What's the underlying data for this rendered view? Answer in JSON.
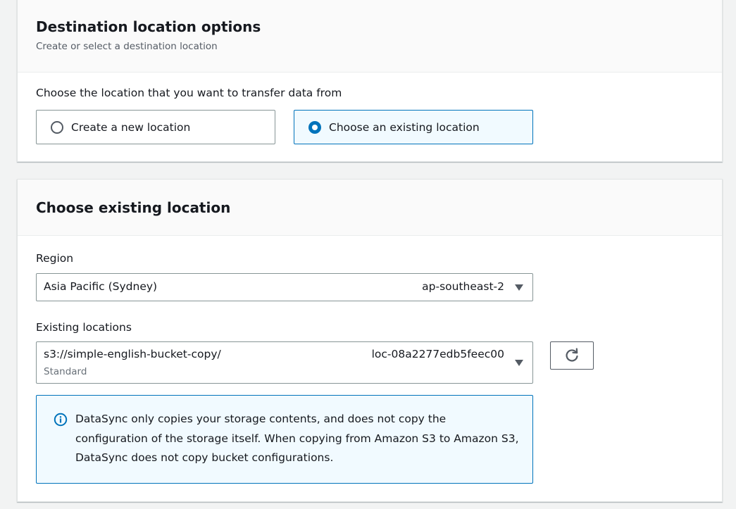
{
  "destination_panel": {
    "title": "Destination location options",
    "description": "Create or select a destination location",
    "choose_label": "Choose the location that you want to transfer data from",
    "options": [
      {
        "label": "Create a new location",
        "selected": false
      },
      {
        "label": "Choose an existing location",
        "selected": true
      }
    ]
  },
  "existing_panel": {
    "title": "Choose existing location",
    "region": {
      "label": "Region",
      "value_name": "Asia Pacific (Sydney)",
      "value_code": "ap-southeast-2",
      "icon": "caret-down-icon"
    },
    "existing_locations": {
      "label": "Existing locations",
      "value_uri": "s3://simple-english-bucket-copy/",
      "value_id": "loc-08a2277edb5feec00",
      "value_sub": "Standard",
      "icon": "caret-down-icon"
    },
    "refresh_icon": "refresh-icon",
    "info_alert": {
      "icon": "info-icon",
      "text": "DataSync only copies your storage contents, and does not copy the configuration of the storage itself. When copying from Amazon S3 to Amazon S3, DataSync does not copy bucket configurations."
    }
  },
  "colors": {
    "accent": "#0073bb",
    "selected_bg": "#f1faff",
    "page_bg": "#f2f3f3"
  }
}
